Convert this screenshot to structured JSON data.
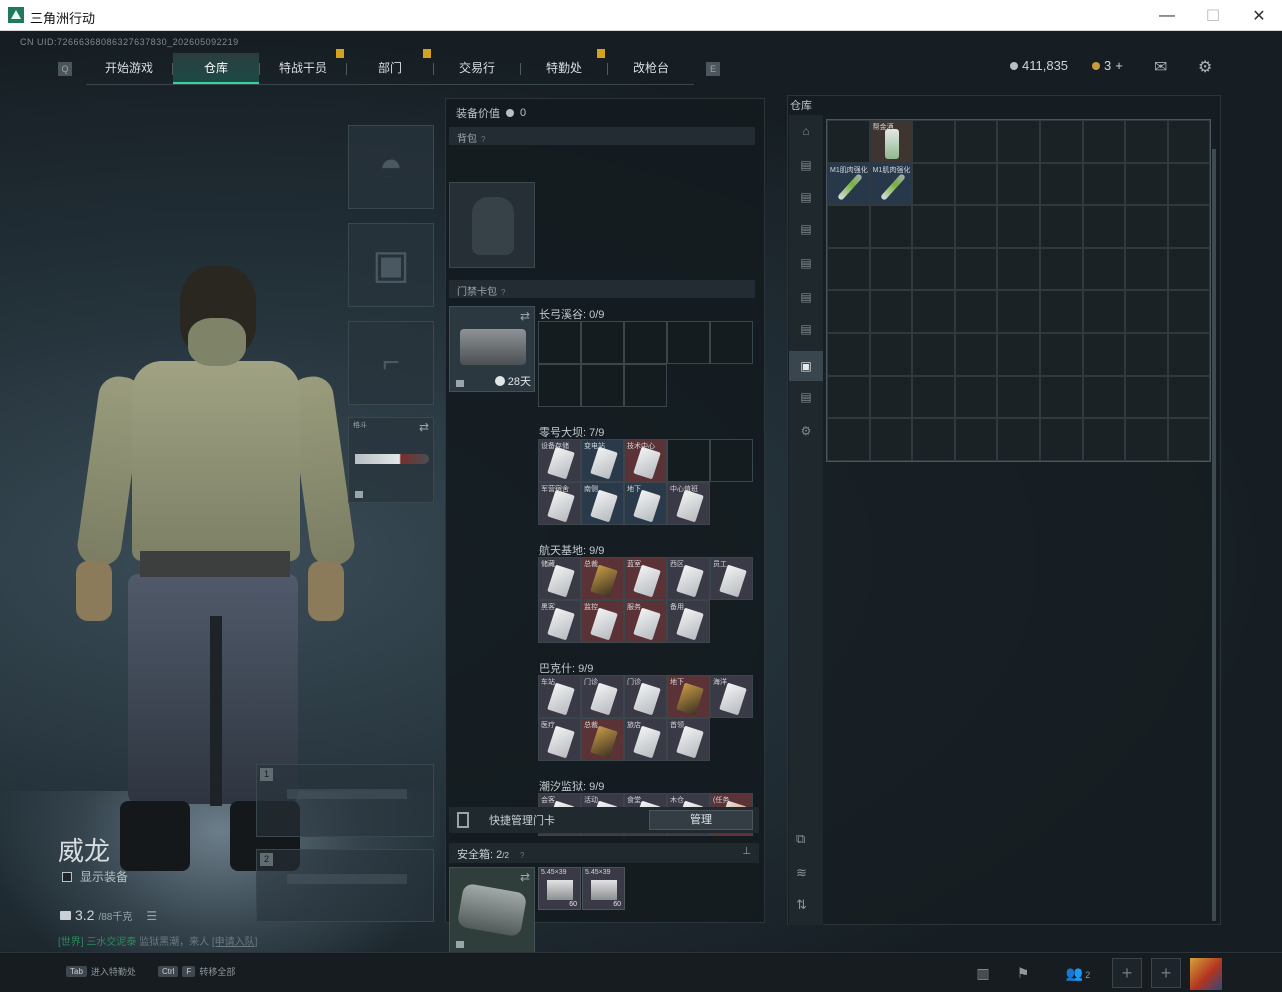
{
  "window": {
    "title": "三角洲行动",
    "min": "—",
    "max": "☐",
    "close": "✕"
  },
  "uid": "CN UID:7266636808632763783​0_2026050922​19",
  "nav": {
    "left_icon": "Q",
    "right_icon": "E",
    "tabs": [
      {
        "label": "开始游戏",
        "active": false,
        "notif": false
      },
      {
        "label": "仓库",
        "active": true,
        "notif": false
      },
      {
        "label": "特战干员",
        "active": false,
        "notif": true
      },
      {
        "label": "部门",
        "active": false,
        "notif": true
      },
      {
        "label": "交易行",
        "active": false,
        "notif": false
      },
      {
        "label": "特勤处",
        "active": false,
        "notif": true
      },
      {
        "label": "改枪台",
        "active": false,
        "notif": false
      }
    ]
  },
  "currency": {
    "silver": "411,835",
    "gold": "3",
    "gold_plus": "+"
  },
  "operator": {
    "name": "威龙",
    "show_equip_label": "显示装备",
    "weight": "3.2",
    "weight_max": "/88千克",
    "chat_channel": "[世界]",
    "chat_user": "三水交泥泰",
    "chat_text": "监狱黑潮，来人",
    "chat_link": "[申请入队]"
  },
  "gear_slots": {
    "melee_label": "格斗"
  },
  "weapon_slots": [
    {
      "num": "1"
    },
    {
      "num": "2"
    }
  ],
  "equip_panel": {
    "value_label": "装备价值",
    "value": "0",
    "backpack_label": "背包",
    "keycard_pack_label": "门禁卡包",
    "keycard_days": "28天",
    "maps": [
      {
        "label": "长弓溪谷: 0/9",
        "cells": [
          {
            "t": "e"
          },
          {
            "t": "e"
          },
          {
            "t": "e"
          },
          {
            "t": "e"
          },
          {
            "t": "e"
          },
          {
            "t": "e"
          },
          {
            "t": "e"
          },
          {
            "t": "e"
          },
          {
            "t": "b"
          },
          {
            "t": "b"
          }
        ]
      },
      {
        "label": "零号大坝: 7/9",
        "cells": [
          {
            "t": "i",
            "c": "normal",
            "n": "设备存储",
            "k": "light"
          },
          {
            "t": "i",
            "c": "blue",
            "n": "变电站",
            "k": "light"
          },
          {
            "t": "i",
            "c": "red",
            "n": "技术中心",
            "k": "light"
          },
          {
            "t": "e"
          },
          {
            "t": "e"
          },
          {
            "t": "i",
            "c": "normal",
            "n": "军营宿舍",
            "k": "light"
          },
          {
            "t": "i",
            "c": "blue",
            "n": "南侧",
            "k": "light"
          },
          {
            "t": "i",
            "c": "blue",
            "n": "地下",
            "k": "light"
          },
          {
            "t": "i",
            "c": "normal",
            "n": "中心值班",
            "k": "light"
          },
          {
            "t": "b"
          }
        ]
      },
      {
        "label": "航天基地: 9/9",
        "cells": [
          {
            "t": "i",
            "c": "normal",
            "n": "储藏",
            "k": "light"
          },
          {
            "t": "i",
            "c": "red",
            "n": "总裁",
            "k": "dark"
          },
          {
            "t": "i",
            "c": "red",
            "n": "蓝室",
            "k": "light"
          },
          {
            "t": "i",
            "c": "normal",
            "n": "西区",
            "k": "light"
          },
          {
            "t": "i",
            "c": "normal",
            "n": "员工",
            "k": "light"
          },
          {
            "t": "i",
            "c": "normal",
            "n": "黑客",
            "k": "light"
          },
          {
            "t": "i",
            "c": "red",
            "n": "监控",
            "k": "light"
          },
          {
            "t": "i",
            "c": "red",
            "n": "服务",
            "k": "light"
          },
          {
            "t": "i",
            "c": "normal",
            "n": "备用",
            "k": "light"
          },
          {
            "t": "b"
          }
        ]
      },
      {
        "label": "巴克什: 9/9",
        "cells": [
          {
            "t": "i",
            "c": "normal",
            "n": "车站",
            "k": "light"
          },
          {
            "t": "i",
            "c": "normal",
            "n": "门诊",
            "k": "light"
          },
          {
            "t": "i",
            "c": "normal",
            "n": "门诊",
            "k": "light"
          },
          {
            "t": "i",
            "c": "red",
            "n": "地下",
            "k": "dark"
          },
          {
            "t": "i",
            "c": "normal",
            "n": "海洋",
            "k": "light"
          },
          {
            "t": "i",
            "c": "normal",
            "n": "医疗",
            "k": "light"
          },
          {
            "t": "i",
            "c": "red",
            "n": "总裁",
            "k": "dark"
          },
          {
            "t": "i",
            "c": "normal",
            "n": "旅店",
            "k": "light"
          },
          {
            "t": "i",
            "c": "normal",
            "n": "首领",
            "k": "light"
          },
          {
            "t": "b"
          }
        ]
      },
      {
        "label": "潮汐监狱: 9/9",
        "cells": [
          {
            "t": "i",
            "c": "normal",
            "n": "会客",
            "k": "light"
          },
          {
            "t": "i",
            "c": "normal",
            "n": "活动",
            "k": "light"
          },
          {
            "t": "i",
            "c": "normal",
            "n": "食堂",
            "k": "light"
          },
          {
            "t": "i",
            "c": "normal",
            "n": "木仓",
            "k": "light"
          },
          {
            "t": "i",
            "c": "red",
            "n": "(任务",
            "k": "orange"
          }
        ]
      }
    ],
    "quick_manage_label": "快捷管理门卡",
    "manage_button": "管理",
    "safe_label": "安全箱: 2",
    "safe_cap": "/2",
    "ammo": [
      {
        "name": "5.45×39",
        "count": "60"
      },
      {
        "name": "5.45×39",
        "count": "60"
      }
    ]
  },
  "storage": {
    "title": "仓库",
    "items": [
      {
        "row": 0,
        "col": 1,
        "name": "帮金酒",
        "kind": "drink"
      },
      {
        "row": 1,
        "col": 0,
        "name": "M1肌肉强化",
        "kind": "syringe"
      },
      {
        "row": 1,
        "col": 1,
        "name": "M1肌肉强化",
        "kind": "syringe"
      }
    ],
    "rows": 8,
    "cols": 9
  },
  "bottom_bar": {
    "tab_key": "Tab",
    "tab_label": "进入特勤处",
    "ctrl_key": "Ctrl",
    "f_key": "F",
    "ctrl_label": "转移全部",
    "friends_count": "2"
  }
}
